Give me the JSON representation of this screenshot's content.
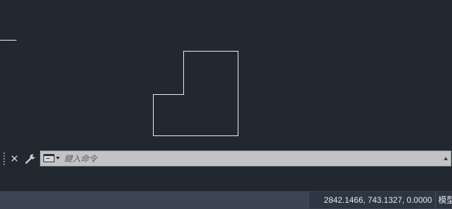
{
  "command_line": {
    "close_icon": "close-icon",
    "wrench_icon": "wrench-icon",
    "prompt_icon": "command-prompt-icon",
    "input_placeholder": "鍵入命令",
    "input_value": ""
  },
  "status_bar": {
    "coordinates": "2842.1466, 743.1327, 0.0000",
    "model_tab_label": "模型"
  },
  "colors": {
    "canvas_background": "#212830",
    "drawing_line": "#ffffff",
    "command_input_background": "#c1c3c4",
    "status_bar_background": "#3b4452"
  }
}
